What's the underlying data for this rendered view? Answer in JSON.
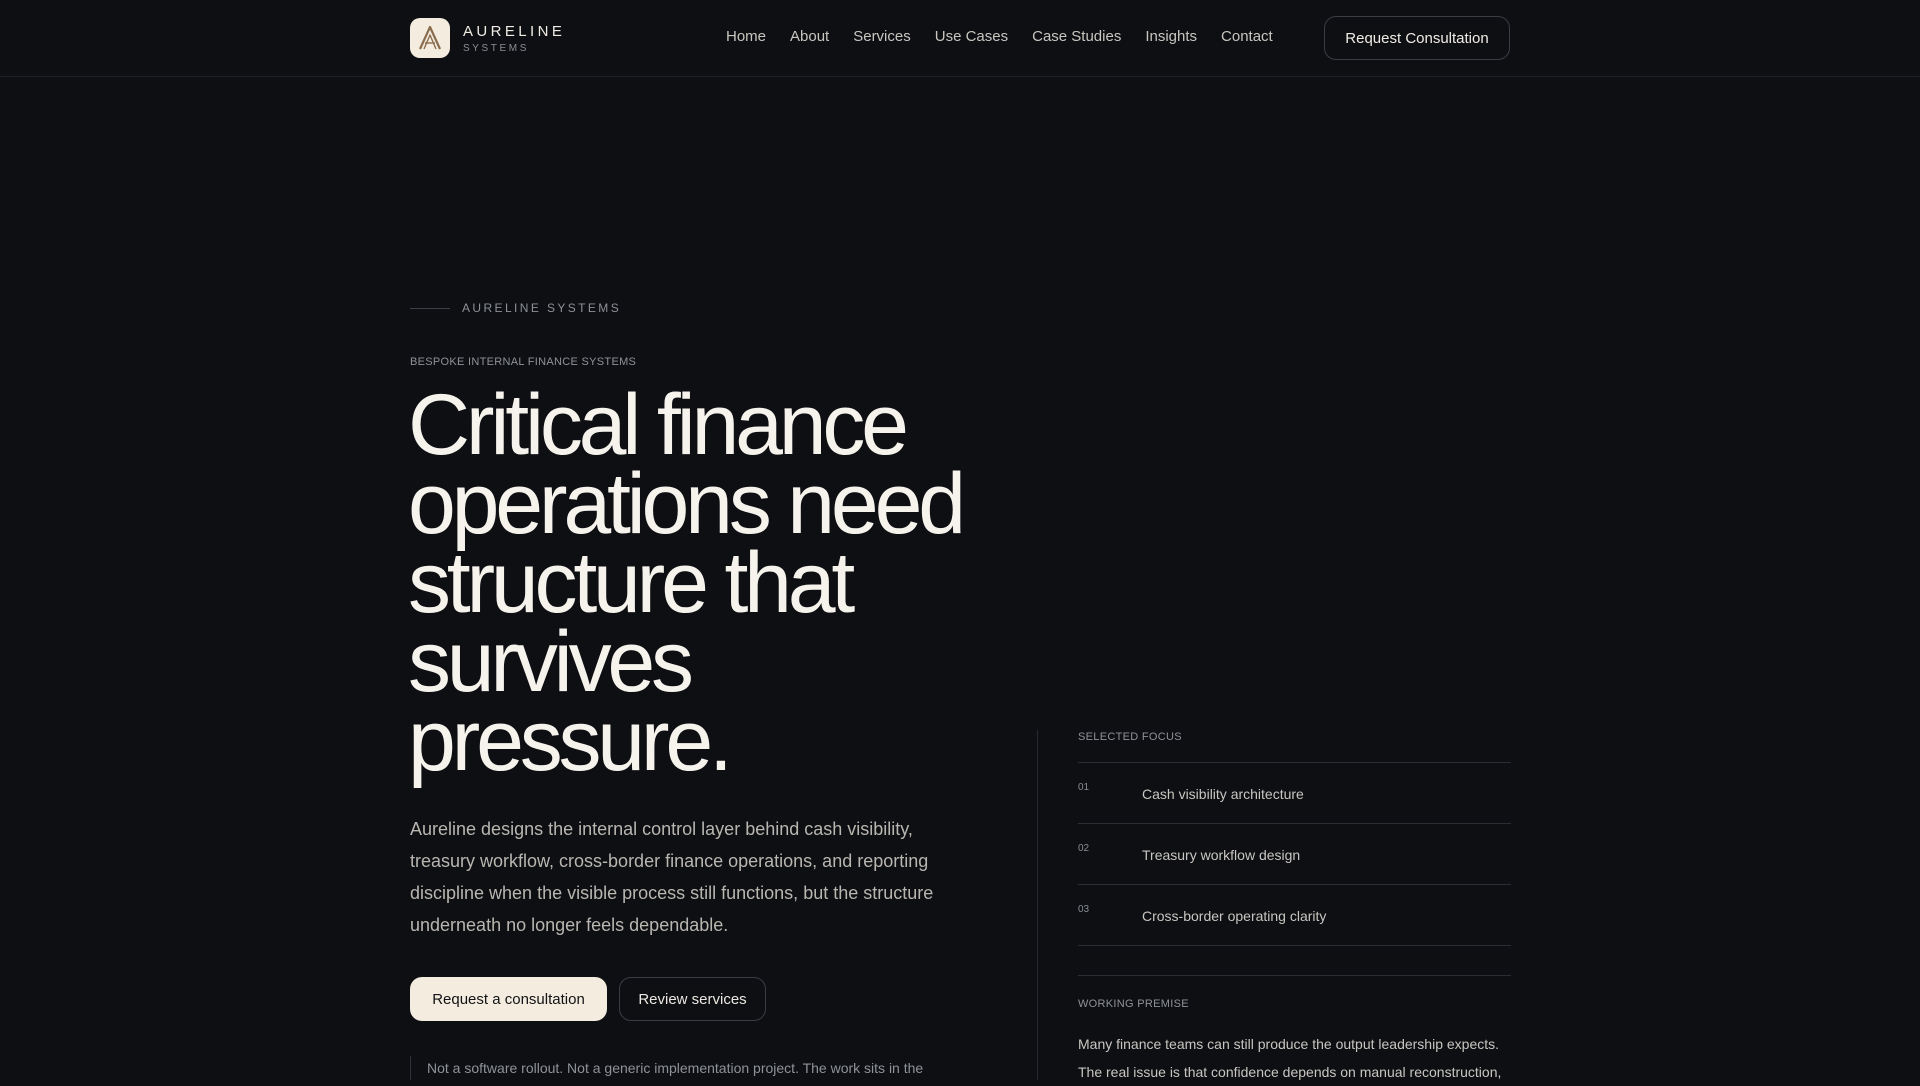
{
  "header": {
    "brand_name": "AURELINE",
    "brand_sub": "SYSTEMS",
    "logo_icon": "letter-a-monogram-icon",
    "nav": [
      {
        "label": "Home"
      },
      {
        "label": "About"
      },
      {
        "label": "Services"
      },
      {
        "label": "Use Cases"
      },
      {
        "label": "Case Studies"
      },
      {
        "label": "Insights"
      },
      {
        "label": "Contact"
      }
    ],
    "cta_label": "Request Consultation"
  },
  "hero": {
    "eyebrow": "AURELINE SYSTEMS",
    "kicker": "BESPOKE INTERNAL FINANCE SYSTEMS",
    "headline": "Critical finance operations need structure that survives pressure.",
    "lead": "Aureline designs the internal control layer behind cash visibility, treasury workflow, cross-border finance operations, and reporting discipline when the visible process still functions, but the structure underneath no longer feels dependable.",
    "primary_button": "Request a consultation",
    "secondary_button": "Review services",
    "note": "Not a software rollout. Not a generic implementation project. The work sits in the"
  },
  "focus": {
    "label": "SELECTED FOCUS",
    "items": [
      {
        "num": "01",
        "text": "Cash visibility architecture"
      },
      {
        "num": "02",
        "text": "Treasury workflow design"
      },
      {
        "num": "03",
        "text": "Cross-border operating clarity"
      }
    ]
  },
  "premise": {
    "label": "WORKING PREMISE",
    "line1": "Many finance teams can still produce the output leadership expects.",
    "line2": "The real issue is that confidence depends on manual reconstruction,"
  },
  "colors": {
    "background": "#0d0f13",
    "accent_cream": "#f4ecdf",
    "text_primary": "#f6f2ec",
    "text_muted": "#8f9298"
  }
}
